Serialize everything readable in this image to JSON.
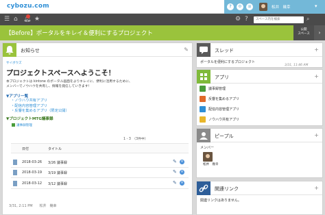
{
  "header": {
    "brand": "cybozu.com",
    "user_name": "松井　幾幸",
    "caret": "▾",
    "circle_icons": [
      "?",
      "⚙",
      "≡"
    ]
  },
  "nav": {
    "search_placeholder": "スペース内を検索",
    "icons": [
      "home-icon",
      "bell-icon",
      "star-icon",
      "gear-icon",
      "help-icon",
      "search-icon"
    ]
  },
  "title_bar": {
    "title": "【Before】ポータルをキレイ＆便利にするプロジェクト",
    "settings_label": "公開\nスペース",
    "chevron": "›"
  },
  "notice": {
    "title": "お知らせ",
    "logo": "サイボウズ",
    "welcome": "プロジェクトスペースへようこそ！",
    "desc1": "本プロジェクトは kintone のポータル画面をよりキレイに、便利に活用するために、",
    "desc2": "メンバーでノウハウを共有し、情報を発信していきます！",
    "apps_title": "▼アプリ一覧",
    "apps": [
      "・ノウハウ共有アプリ",
      "・配信内容管理アプリ",
      "・反響を集めるアプリ（限定公開）"
    ],
    "mtg_title": "▼プロジェクトMTG議事録",
    "mtg_link": "議事録管理",
    "pager": "1 - 3　（3件中）",
    "table_headers": [
      "日付",
      "タイトル"
    ],
    "rows": [
      {
        "date": "2018-03-26",
        "title": "3/26 議事録"
      },
      {
        "date": "2018-03-19",
        "title": "3/19 議事録"
      },
      {
        "date": "2018-03-12",
        "title": "3/12 議事録"
      }
    ],
    "footer": "3/31, 2:11 PM　　松井　幾幸"
  },
  "thread": {
    "title": "スレッド",
    "item": "ポータルを便利にするプロジェクト",
    "time": "3/31, 11:46 AM"
  },
  "apps_panel": {
    "title": "アプリ",
    "items": [
      {
        "name": "議事録管理",
        "color": "#4a9c3a"
      },
      {
        "name": "反響を集めるアプリ",
        "color": "#e06a2b"
      },
      {
        "name": "配信内容管理アプリ",
        "color": "#2e8fd6"
      },
      {
        "name": "ノウハウ共有アプリ",
        "color": "#e8b62a"
      }
    ]
  },
  "people": {
    "title": "ピープル",
    "member_label": "メンバー",
    "member_name": "松井　幾幸"
  },
  "links": {
    "title": "関連リンク",
    "empty_text": "関連リンクはありません。"
  },
  "colors": {
    "title_bar": "#9ac33c",
    "header_accent": "#73b8d8",
    "nav_bg": "#4a4a4a",
    "link_blue": "#2e8fd6"
  }
}
